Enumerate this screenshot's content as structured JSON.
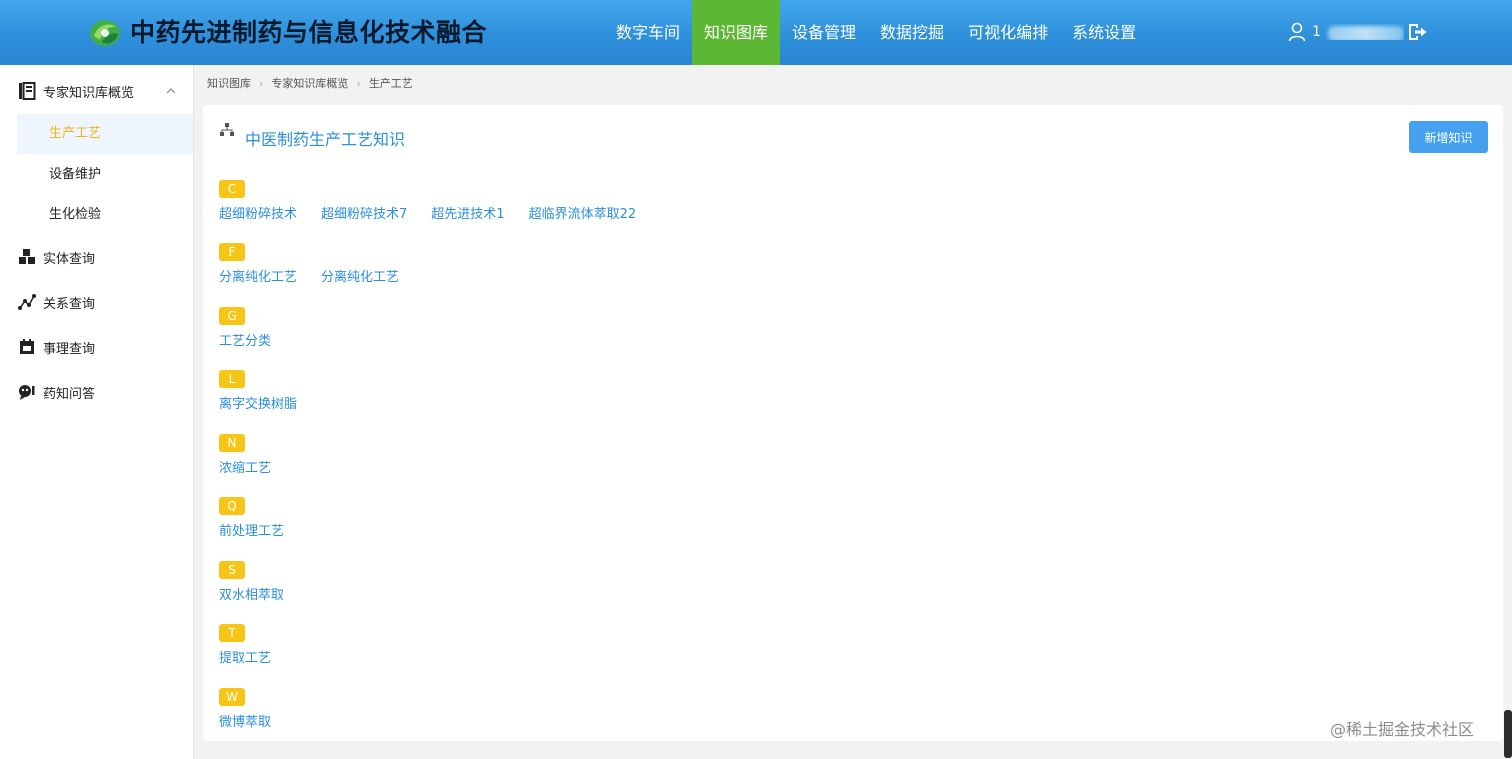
{
  "header": {
    "title": "中药先进制药与信息化技术融合",
    "nav": [
      {
        "label": "数字车间",
        "active": false
      },
      {
        "label": "知识图库",
        "active": true
      },
      {
        "label": "设备管理",
        "active": false
      },
      {
        "label": "数据挖掘",
        "active": false
      },
      {
        "label": "可视化编排",
        "active": false
      },
      {
        "label": "系统设置",
        "active": false
      }
    ],
    "user_name": "1",
    "colors": {
      "bar": "#2e90db",
      "nav_active": "#5cb834"
    }
  },
  "sidebar": {
    "group_label": "专家知识库概览",
    "sub_items": [
      {
        "label": "生产工艺",
        "active": true
      },
      {
        "label": "设备维护",
        "active": false
      },
      {
        "label": "生化检验",
        "active": false
      }
    ],
    "items": [
      {
        "label": "实体查询",
        "icon": "cubes-icon"
      },
      {
        "label": "关系查询",
        "icon": "relation-graph-icon"
      },
      {
        "label": "事理查询",
        "icon": "calendar-icon"
      },
      {
        "label": "药知问答",
        "icon": "chat-bot-icon"
      }
    ]
  },
  "breadcrumb": [
    "知识图库",
    "专家知识库概览",
    "生产工艺"
  ],
  "main": {
    "title": "中医制药生产工艺知识",
    "add_button": "新增知识",
    "groups": [
      {
        "letter": "C",
        "items": [
          "超细粉碎技术",
          "超细粉碎技术7",
          "超先进技术1",
          "超临界流体萃取22"
        ]
      },
      {
        "letter": "F",
        "items": [
          "分离纯化工艺",
          "分离纯化工艺"
        ]
      },
      {
        "letter": "G",
        "items": [
          "工艺分类"
        ]
      },
      {
        "letter": "L",
        "items": [
          "离字交换树脂"
        ]
      },
      {
        "letter": "N",
        "items": [
          "浓缩工艺"
        ]
      },
      {
        "letter": "Q",
        "items": [
          "前处理工艺"
        ]
      },
      {
        "letter": "S",
        "items": [
          "双水相萃取"
        ]
      },
      {
        "letter": "T",
        "items": [
          "提取工艺"
        ]
      },
      {
        "letter": "W",
        "items": [
          "微博萃取"
        ]
      }
    ],
    "colors": {
      "badge": "#f7c515",
      "link": "#2a8ee0",
      "button": "#45a1f0"
    }
  },
  "watermark": "@稀土掘金技术社区"
}
